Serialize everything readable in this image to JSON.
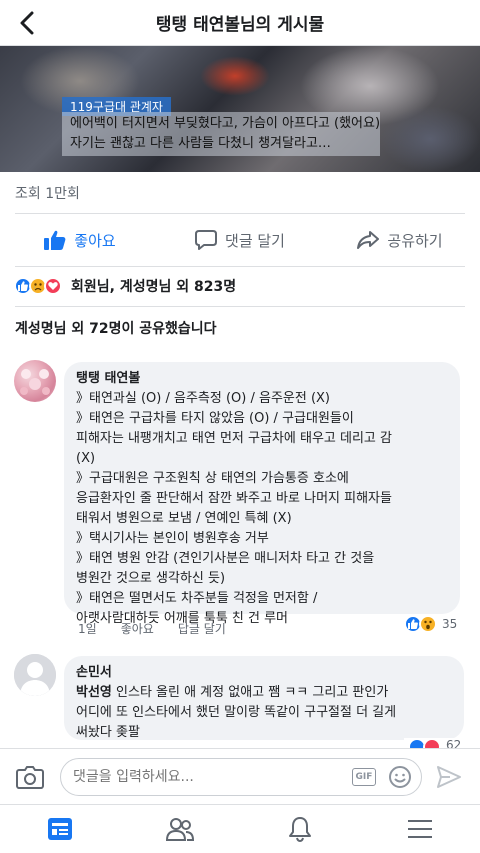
{
  "header": {
    "title": "탱탱 태연볼님의 게시물"
  },
  "video": {
    "caption_tag": "119구급대 관계자",
    "caption_lines": [
      "에어백이 터지면서 부딪혔다고, 가슴이 아프다고 (했어요)",
      "자기는 괜찮고 다른 사람들 다쳤니 챙겨달라고…"
    ]
  },
  "views": "조회 1만회",
  "actions": {
    "like": "좋아요",
    "comment": "댓글 달기",
    "share": "공유하기"
  },
  "reactions": {
    "text": "회원님, 계성명님 외 823명"
  },
  "share_summary": "계성명님 외 72명이 공유했습니다",
  "comments": [
    {
      "name": "탱탱 태연볼",
      "lines": [
        "》태연과실 (O) / 음주측정 (O) / 음주운전 (X)",
        "》태연은 구급차를 타지 않았음 (O) / 구급대원들이",
        "피해자는 내팽개치고 태연 먼저 구급차에 태우고 데리고 감",
        "(X)",
        "》구급대원은 구조원칙 상 태연의 가슴통증 호소에",
        "응급환자인 줄 판단해서 잠깐 봐주고 바로 나머지 피해자들",
        "태워서 병원으로 보냄 / 연예인 특혜 (X)",
        "》택시기사는 본인이 병원후송 거부",
        "》태연 병원 안감 (견인기사분은 매니저차 타고 간 것을",
        "병원간 것으로 생각하신 듯)",
        "》태연은 떨면서도 차주분들 걱정을 먼저함 /",
        "아랫사람대하듯 어깨를 툭툭 친 건 루머"
      ],
      "time": "1일",
      "like_label": "좋아요",
      "reply_label": "답글 달기",
      "reaction_count": "35"
    },
    {
      "name": "손민서",
      "tagged": "박선영",
      "lines": [
        " 인스타 올린 애 계정 없애고 쨈 ㅋㅋ 그리고 판인가",
        "어디에 또 인스타에서 했던 말이랑 똑같이 구구절절 더 길게",
        "써놨다 좆팔"
      ],
      "reaction_count": "62"
    }
  ],
  "composer": {
    "placeholder": "댓글을 입력하세요...",
    "gif_label": "GIF"
  },
  "colors": {
    "accent": "#1877f2",
    "bubble": "#f0f2f5",
    "muted": "#606770"
  }
}
